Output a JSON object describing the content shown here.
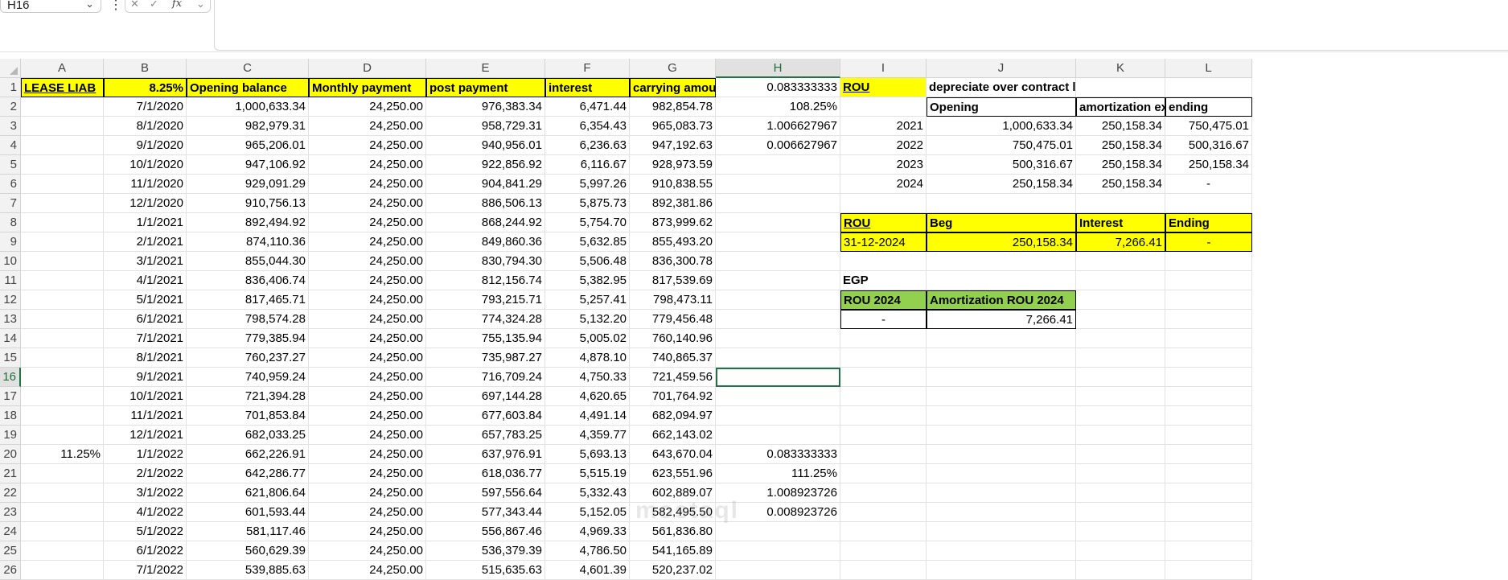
{
  "formula_bar": {
    "name_box": "H16",
    "formula_label": "fx",
    "formula": ""
  },
  "columns": [
    "A",
    "B",
    "C",
    "D",
    "E",
    "F",
    "G",
    "H",
    "I",
    "J",
    "K",
    "L"
  ],
  "selected_cell": "H16",
  "colors": {
    "yellow": "#ffff00",
    "green": "#92d050",
    "selection": "#217346"
  },
  "cells": {
    "A1": "LEASE LIAB",
    "B1": "8.25%",
    "C1": "Opening balance",
    "D1": "Monthly payment",
    "E1": "post payment",
    "F1": "interest",
    "G1": "carrying amount",
    "H1": "0.083333333",
    "I1": "ROU",
    "J1": "depreciate over contract life",
    "B2": "7/1/2020",
    "C2": "1,000,633.34",
    "D2": "24,250.00",
    "E2": "976,383.34",
    "F2": "6,471.44",
    "G2": "982,854.78",
    "H2": "108.25%",
    "J2": "Opening",
    "K2": "amortization exp",
    "L2": "ending",
    "B3": "8/1/2020",
    "C3": "982,979.31",
    "D3": "24,250.00",
    "E3": "958,729.31",
    "F3": "6,354.43",
    "G3": "965,083.73",
    "H3": "1.006627967",
    "I3": "2021",
    "J3": "1,000,633.34",
    "K3": "250,158.34",
    "L3": "750,475.01",
    "B4": "9/1/2020",
    "C4": "965,206.01",
    "D4": "24,250.00",
    "E4": "940,956.01",
    "F4": "6,236.63",
    "G4": "947,192.63",
    "H4": "0.006627967",
    "I4": "2022",
    "J4": "750,475.01",
    "K4": "250,158.34",
    "L4": "500,316.67",
    "B5": "10/1/2020",
    "C5": "947,106.92",
    "D5": "24,250.00",
    "E5": "922,856.92",
    "F5": "6,116.67",
    "G5": "928,973.59",
    "I5": "2023",
    "J5": "500,316.67",
    "K5": "250,158.34",
    "L5": "250,158.34",
    "B6": "11/1/2020",
    "C6": "929,091.29",
    "D6": "24,250.00",
    "E6": "904,841.29",
    "F6": "5,997.26",
    "G6": "910,838.55",
    "I6": "2024",
    "J6": "250,158.34",
    "K6": "250,158.34",
    "L6": "-",
    "B7": "12/1/2020",
    "C7": "910,756.13",
    "D7": "24,250.00",
    "E7": "886,506.13",
    "F7": "5,875.73",
    "G7": "892,381.86",
    "B8": "1/1/2021",
    "C8": "892,494.92",
    "D8": "24,250.00",
    "E8": "868,244.92",
    "F8": "5,754.70",
    "G8": "873,999.62",
    "I8": "ROU",
    "J8": "Beg",
    "K8": "Interest",
    "L8": "Ending",
    "B9": "2/1/2021",
    "C9": "874,110.36",
    "D9": "24,250.00",
    "E9": "849,860.36",
    "F9": "5,632.85",
    "G9": "855,493.20",
    "I9": "31-12-2024",
    "J9": "250,158.34",
    "K9": "7,266.41",
    "L9": "-",
    "B10": "3/1/2021",
    "C10": "855,044.30",
    "D10": "24,250.00",
    "E10": "830,794.30",
    "F10": "5,506.48",
    "G10": "836,300.78",
    "B11": "4/1/2021",
    "C11": "836,406.74",
    "D11": "24,250.00",
    "E11": "812,156.74",
    "F11": "5,382.95",
    "G11": "817,539.69",
    "I11": "EGP",
    "B12": "5/1/2021",
    "C12": "817,465.71",
    "D12": "24,250.00",
    "E12": "793,215.71",
    "F12": "5,257.41",
    "G12": "798,473.11",
    "I12": "ROU 2024",
    "J12": "Amortization ROU 2024",
    "B13": "6/1/2021",
    "C13": "798,574.28",
    "D13": "24,250.00",
    "E13": "774,324.28",
    "F13": "5,132.20",
    "G13": "779,456.48",
    "I13": "-",
    "J13": "7,266.41",
    "B14": "7/1/2021",
    "C14": "779,385.94",
    "D14": "24,250.00",
    "E14": "755,135.94",
    "F14": "5,005.02",
    "G14": "760,140.96",
    "B15": "8/1/2021",
    "C15": "760,237.27",
    "D15": "24,250.00",
    "E15": "735,987.27",
    "F15": "4,878.10",
    "G15": "740,865.37",
    "B16": "9/1/2021",
    "C16": "740,959.24",
    "D16": "24,250.00",
    "E16": "716,709.24",
    "F16": "4,750.33",
    "G16": "721,459.56",
    "B17": "10/1/2021",
    "C17": "721,394.28",
    "D17": "24,250.00",
    "E17": "697,144.28",
    "F17": "4,620.65",
    "G17": "701,764.92",
    "B18": "11/1/2021",
    "C18": "701,853.84",
    "D18": "24,250.00",
    "E18": "677,603.84",
    "F18": "4,491.14",
    "G18": "682,094.97",
    "B19": "12/1/2021",
    "C19": "682,033.25",
    "D19": "24,250.00",
    "E19": "657,783.25",
    "F19": "4,359.77",
    "G19": "662,143.02",
    "A20": "11.25%",
    "B20": "1/1/2022",
    "C20": "662,226.91",
    "D20": "24,250.00",
    "E20": "637,976.91",
    "F20": "5,693.13",
    "G20": "643,670.04",
    "H20": "0.083333333",
    "B21": "2/1/2022",
    "C21": "642,286.77",
    "D21": "24,250.00",
    "E21": "618,036.77",
    "F21": "5,515.19",
    "G21": "623,551.96",
    "H21": "111.25%",
    "B22": "3/1/2022",
    "C22": "621,806.64",
    "D22": "24,250.00",
    "E22": "597,556.64",
    "F22": "5,332.43",
    "G22": "602,889.07",
    "H22": "1.008923726",
    "B23": "4/1/2022",
    "C23": "601,593.44",
    "D23": "24,250.00",
    "E23": "577,343.44",
    "F23": "5,152.05",
    "G23": "582,495.50",
    "H23": "0.008923726",
    "B24": "5/1/2022",
    "C24": "581,117.46",
    "D24": "24,250.00",
    "E24": "556,867.46",
    "F24": "4,969.33",
    "G24": "561,836.80",
    "B25": "6/1/2022",
    "C25": "560,629.39",
    "D25": "24,250.00",
    "E25": "536,379.39",
    "F25": "4,786.50",
    "G25": "541,165.89",
    "B26": "7/1/2022",
    "C26": "539,885.63",
    "D26": "24,250.00",
    "E26": "515,635.63",
    "F26": "4,601.39",
    "G26": "520,237.02"
  }
}
